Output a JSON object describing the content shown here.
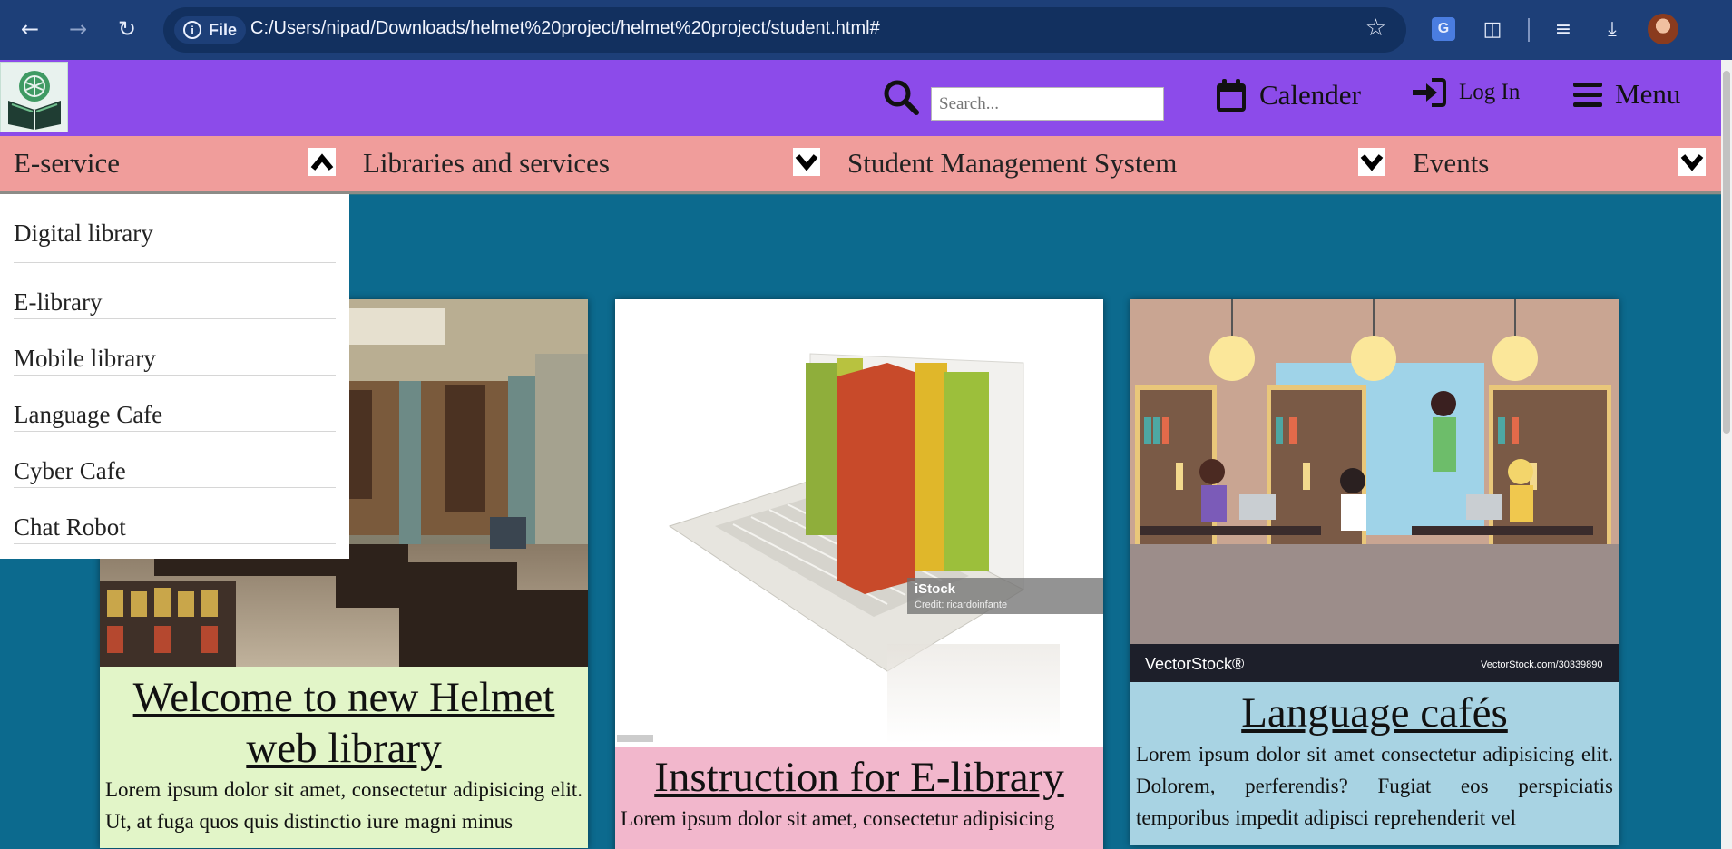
{
  "browser": {
    "file_chip_label": "File",
    "url": "C:/Users/nipad/Downloads/helmet%20project/helmet%20project/student.html#",
    "icons": [
      "back-icon",
      "forward-icon",
      "reload-icon",
      "info-icon",
      "star-icon",
      "google-translate-icon",
      "extensions-icon",
      "playlist-icon",
      "download-icon"
    ]
  },
  "header": {
    "search_placeholder": "Search...",
    "calendar_label": "Calender",
    "login_label": "Log In",
    "menu_label": "Menu",
    "brand_color": "#8c4bea"
  },
  "categories": [
    {
      "label": "E-service",
      "state": "expanded"
    },
    {
      "label": "Libraries and services",
      "state": "collapsed"
    },
    {
      "label": "Student Management System",
      "state": "collapsed"
    },
    {
      "label": "Events",
      "state": "collapsed"
    }
  ],
  "dropdown": {
    "items": [
      "Digital library",
      "E-library",
      "Mobile library",
      "Language Cafe",
      "Cyber Cafe",
      "Chat Robot"
    ]
  },
  "cards": [
    {
      "title": "Welcome to new Helmet web library",
      "text": "Lorem ipsum dolor sit amet, consectetur adipisicing elit. Ut, at fuga quos quis distinctio iure magni minus",
      "bg": "#e2f5c8",
      "image": "library-hall-photo"
    },
    {
      "title": "Instruction for E-library",
      "text": "Lorem ipsum dolor sit amet, consectetur adipisicing",
      "bg": "#f2b7cc",
      "image": "laptop-books-photo",
      "watermark_title": "iStock",
      "watermark_credit": "Credit: ricardoinfante"
    },
    {
      "title": "Language cafés",
      "text": "Lorem ipsum dolor sit amet consectetur adipisicing elit. Dolorem, perferendis? Fugiat eos perspiciatis temporibus impedit adipisci reprehenderit vel",
      "bg": "#a8d3e3",
      "image": "library-cafe-illustration",
      "watermark_brand": "VectorStock®",
      "watermark_url": "VectorStock.com/30339890"
    }
  ]
}
